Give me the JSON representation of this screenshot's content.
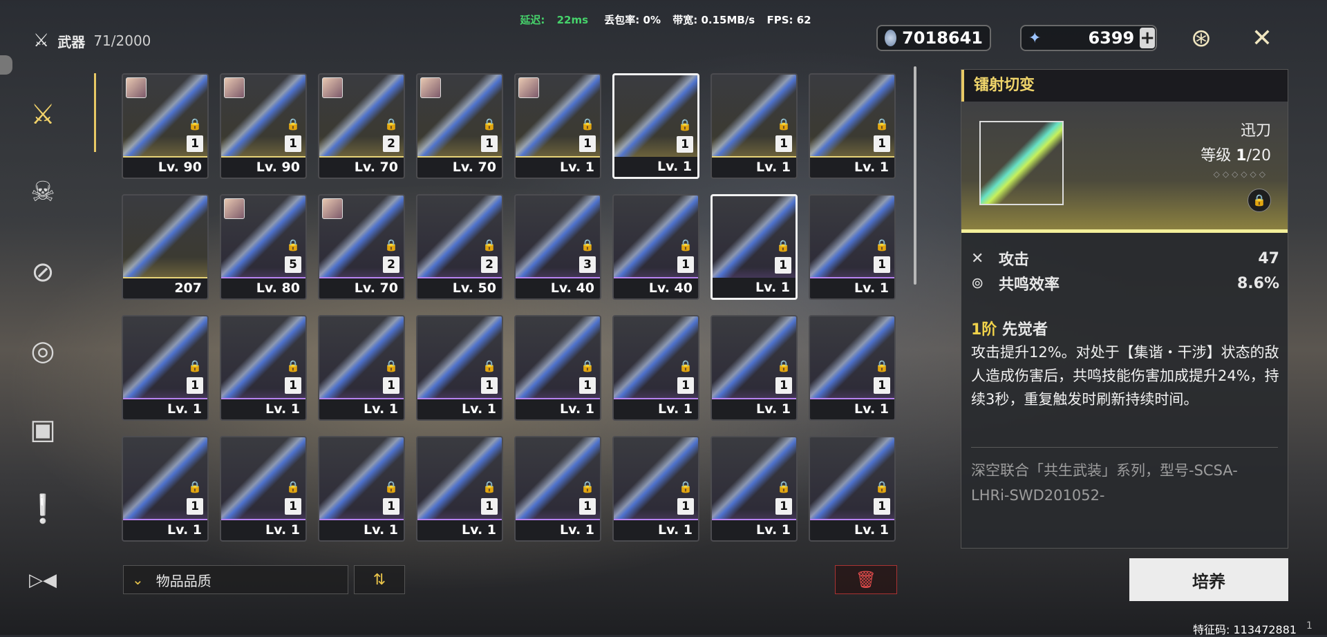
{
  "status": {
    "latency_label": "延迟:",
    "latency": "22ms",
    "loss": "丢包率: 0%",
    "bandwidth": "带宽: 0.15MB/s",
    "fps": "FPS: 62"
  },
  "header": {
    "title": "武器",
    "count": "71/2000"
  },
  "currency": {
    "coins": "7018641",
    "stars": "6399",
    "plus": "+"
  },
  "nav": {
    "icons": [
      "swords-icon",
      "mask-icon",
      "bandage-icon",
      "echo-icon",
      "chest-icon",
      "notice-icon",
      "arrow-icon"
    ]
  },
  "weapons": [
    {
      "lv": "Lv. 90",
      "rank": "1",
      "quality": "gold",
      "avatar": true
    },
    {
      "lv": "Lv. 90",
      "rank": "1",
      "quality": "gold",
      "avatar": true
    },
    {
      "lv": "Lv. 70",
      "rank": "2",
      "quality": "gold",
      "avatar": true
    },
    {
      "lv": "Lv. 70",
      "rank": "1",
      "quality": "gold",
      "avatar": true
    },
    {
      "lv": "Lv. 1",
      "rank": "1",
      "quality": "gold",
      "avatar": true
    },
    {
      "lv": "Lv. 1",
      "rank": "1",
      "quality": "gold",
      "selected": true
    },
    {
      "lv": "Lv. 1",
      "rank": "1",
      "quality": "gold"
    },
    {
      "lv": "Lv. 1",
      "rank": "1",
      "quality": "gold"
    },
    {
      "lv": "207",
      "rank": "",
      "quality": "gold",
      "nolock": true
    },
    {
      "lv": "Lv. 80",
      "rank": "5",
      "quality": "purple",
      "avatar": true
    },
    {
      "lv": "Lv. 70",
      "rank": "2",
      "quality": "purple",
      "avatar": true
    },
    {
      "lv": "Lv. 50",
      "rank": "2",
      "quality": "purple"
    },
    {
      "lv": "Lv. 40",
      "rank": "3",
      "quality": "purple"
    },
    {
      "lv": "Lv. 40",
      "rank": "1",
      "quality": "purple"
    },
    {
      "lv": "Lv. 1",
      "rank": "1",
      "quality": "purple",
      "selected2": true
    },
    {
      "lv": "Lv. 1",
      "rank": "1",
      "quality": "purple"
    },
    {
      "lv": "Lv. 1",
      "rank": "1",
      "quality": "purple"
    },
    {
      "lv": "Lv. 1",
      "rank": "1",
      "quality": "purple"
    },
    {
      "lv": "Lv. 1",
      "rank": "1",
      "quality": "purple"
    },
    {
      "lv": "Lv. 1",
      "rank": "1",
      "quality": "purple"
    },
    {
      "lv": "Lv. 1",
      "rank": "1",
      "quality": "purple"
    },
    {
      "lv": "Lv. 1",
      "rank": "1",
      "quality": "purple"
    },
    {
      "lv": "Lv. 1",
      "rank": "1",
      "quality": "purple"
    },
    {
      "lv": "Lv. 1",
      "rank": "1",
      "quality": "purple"
    },
    {
      "lv": "Lv. 1",
      "rank": "1",
      "quality": "purple"
    },
    {
      "lv": "Lv. 1",
      "rank": "1",
      "quality": "purple"
    },
    {
      "lv": "Lv. 1",
      "rank": "1",
      "quality": "purple"
    },
    {
      "lv": "Lv. 1",
      "rank": "1",
      "quality": "purple"
    },
    {
      "lv": "Lv. 1",
      "rank": "1",
      "quality": "purple"
    },
    {
      "lv": "Lv. 1",
      "rank": "1",
      "quality": "purple"
    },
    {
      "lv": "Lv. 1",
      "rank": "1",
      "quality": "purple"
    },
    {
      "lv": "Lv. 1",
      "rank": "1",
      "quality": "purple"
    }
  ],
  "filter": {
    "label": "物品品质",
    "chevron": "⌄",
    "sort_icon": "⇅"
  },
  "detail": {
    "name": "镭射切变",
    "type": "迅刀",
    "level_label": "等级",
    "level_cur": "1",
    "level_max": "/20",
    "stars": "◇◇◇◇◇◇",
    "stats": [
      {
        "icon": "attack-icon",
        "label": "攻击",
        "value": "47"
      },
      {
        "icon": "resonance-icon",
        "label": "共鸣效率",
        "value": "8.6%"
      }
    ],
    "rank_prefix": "1阶",
    "rank_name": "先觉者",
    "desc": "攻击提升12%。对处于【集谐・干涉】状态的敌人造成伤害后，共鸣技能伤害加成提升24%，持续3秒，重复触发时刷新持续时间。",
    "lore": "深空联合「共生武装」系列，型号-SCSA-LHRi-SWD201052-"
  },
  "cultivate": "培养",
  "feature_code": "特征码: 113472881",
  "page": "1"
}
